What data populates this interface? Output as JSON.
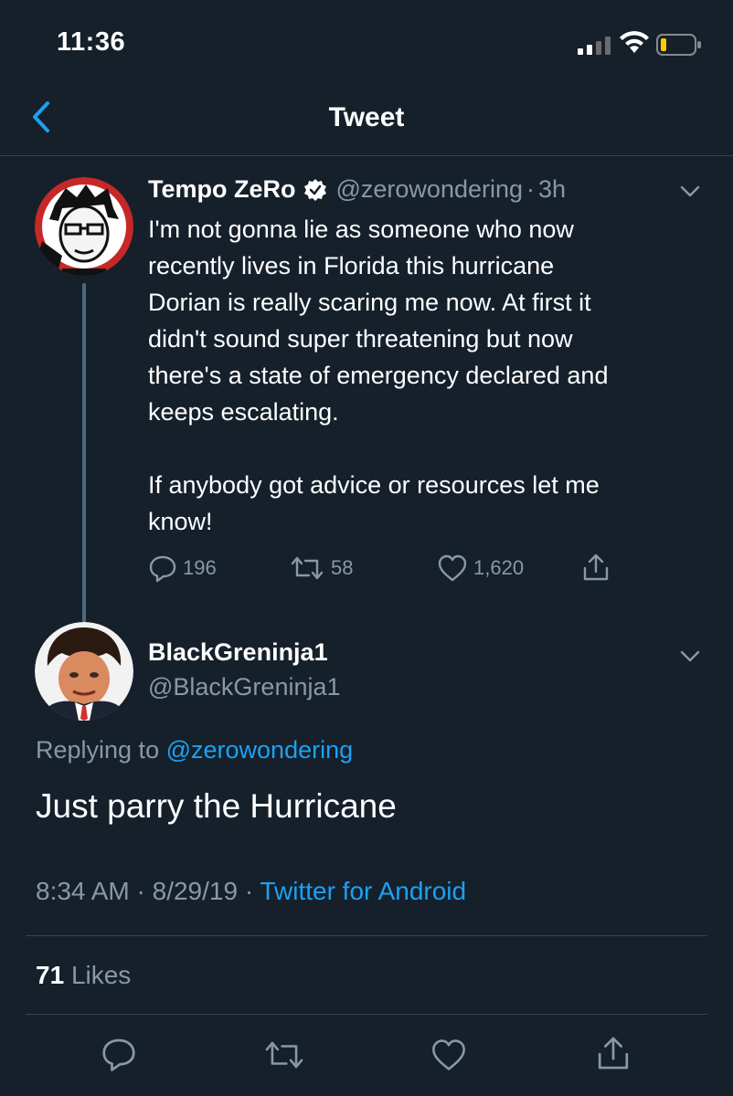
{
  "status_bar": {
    "time": "11:36"
  },
  "nav": {
    "title": "Tweet"
  },
  "parent_tweet": {
    "display_name": "Tempo ZeRo",
    "handle": "@zerowondering",
    "sep": "·",
    "age": "3h",
    "text": "I'm not gonna lie as someone who now\nrecently lives in Florida this hurricane\nDorian is really scaring me now. At first it\ndidn't sound super threatening but now\nthere's a state of emergency declared and\nkeeps escalating.\n\nIf anybody got advice or resources let me\nknow!",
    "replies": "196",
    "retweets": "58",
    "likes": "1,620"
  },
  "main_tweet": {
    "display_name": "BlackGreninja1",
    "handle": "@BlackGreninja1",
    "replying_prefix": "Replying to",
    "replying_to": "@zerowondering",
    "text": "Just parry the Hurricane",
    "time": "8:34 AM",
    "date": "8/29/19",
    "sep": "·",
    "source": "Twitter for Android",
    "likes_count": "71",
    "likes_label": "Likes"
  },
  "colors": {
    "background": "#15202b",
    "accent": "#1da1f2",
    "muted": "#8899a6",
    "divider": "#38444d"
  },
  "icons": [
    "back-chevron-icon",
    "verified-badge-icon",
    "reply-icon",
    "retweet-icon",
    "like-icon",
    "share-icon",
    "chevron-down-icon"
  ]
}
